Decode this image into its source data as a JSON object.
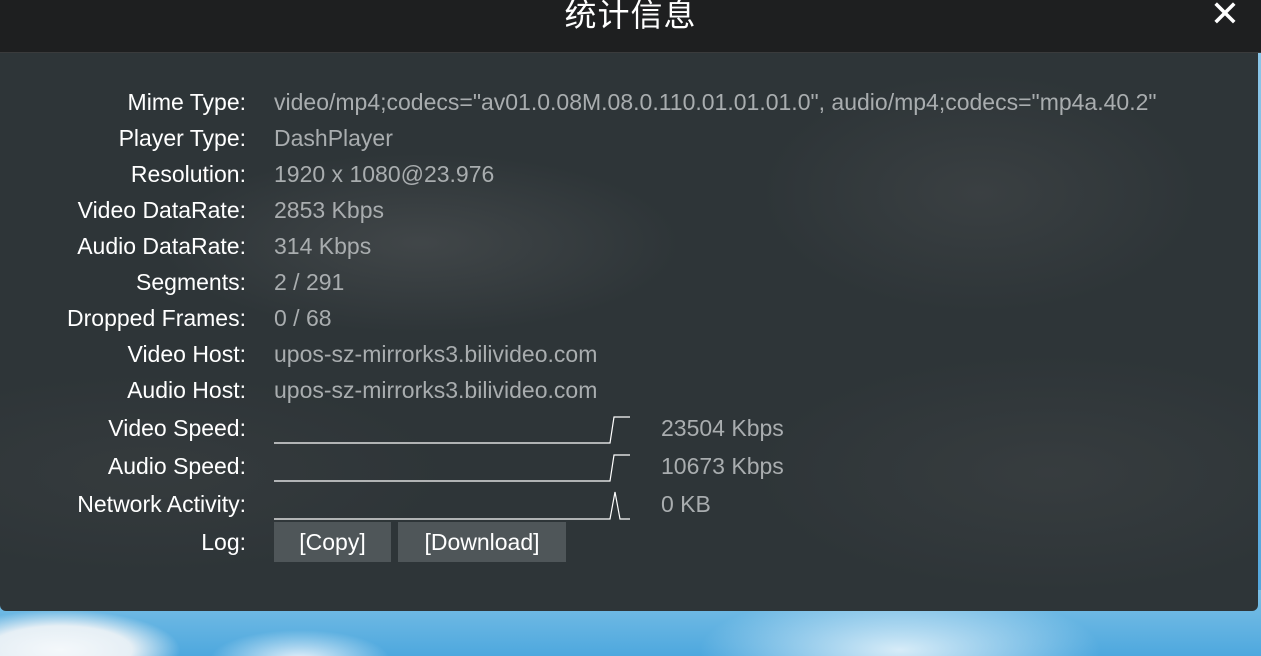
{
  "window": {
    "title": "统计信息",
    "close_label": "✕"
  },
  "stats": [
    {
      "label": "Mime Type:",
      "value": "video/mp4;codecs=\"av01.0.08M.08.0.110.01.01.01.0\", audio/mp4;codecs=\"mp4a.40.2\""
    },
    {
      "label": "Player Type:",
      "value": "DashPlayer"
    },
    {
      "label": "Resolution:",
      "value": "1920 x 1080@23.976"
    },
    {
      "label": "Video DataRate:",
      "value": "2853 Kbps"
    },
    {
      "label": "Audio DataRate:",
      "value": "314 Kbps"
    },
    {
      "label": "Segments:",
      "value": "2 / 291"
    },
    {
      "label": "Dropped Frames:",
      "value": "0 / 68"
    },
    {
      "label": "Video Host:",
      "value": "upos-sz-mirrorks3.bilivideo.com"
    },
    {
      "label": "Audio Host:",
      "value": "upos-sz-mirrorks3.bilivideo.com"
    }
  ],
  "graphs": [
    {
      "label": "Video Speed:",
      "value": "23504 Kbps"
    },
    {
      "label": "Audio Speed:",
      "value": "10673 Kbps"
    },
    {
      "label": "Network Activity:",
      "value": "0 KB"
    }
  ],
  "log": {
    "label": "Log:",
    "copy_label": "[Copy]",
    "download_label": "[Download]"
  }
}
